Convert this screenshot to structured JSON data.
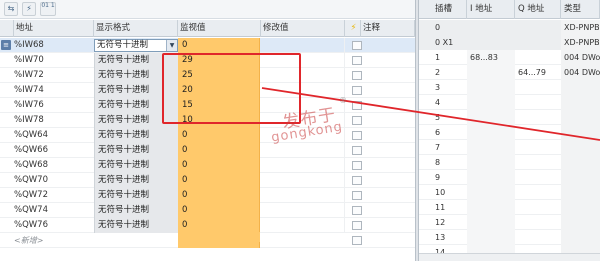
{
  "toolbar": {
    "buttons": [
      {
        "name": "monitor-all-icon",
        "glyph": "⇆"
      },
      {
        "name": "modify-values-icon",
        "glyph": "⚡"
      },
      {
        "name": "monitor-once-icon",
        "glyph": "01\n1"
      }
    ]
  },
  "watch_table": {
    "headers": {
      "address": "地址",
      "format": "显示格式",
      "monitor": "监视值",
      "modify": "修改值",
      "flash_icon": "",
      "comment": "注释"
    },
    "rows": [
      {
        "address": "%IW68",
        "format": "无符号十进制",
        "monitor": "0",
        "selected": true
      },
      {
        "address": "%IW70",
        "format": "无符号十进制",
        "monitor": "29"
      },
      {
        "address": "%IW72",
        "format": "无符号十进制",
        "monitor": "25"
      },
      {
        "address": "%IW74",
        "format": "无符号十进制",
        "monitor": "20"
      },
      {
        "address": "%IW76",
        "format": "无符号十进制",
        "monitor": "15"
      },
      {
        "address": "%IW78",
        "format": "无符号十进制",
        "monitor": "10"
      },
      {
        "address": "%QW64",
        "format": "无符号十进制",
        "monitor": "0"
      },
      {
        "address": "%QW66",
        "format": "无符号十进制",
        "monitor": "0"
      },
      {
        "address": "%QW68",
        "format": "无符号十进制",
        "monitor": "0"
      },
      {
        "address": "%QW70",
        "format": "无符号十进制",
        "monitor": "0"
      },
      {
        "address": "%QW72",
        "format": "无符号十进制",
        "monitor": "0"
      },
      {
        "address": "%QW74",
        "format": "无符号十进制",
        "monitor": "0"
      },
      {
        "address": "%QW76",
        "format": "无符号十进制",
        "monitor": "0"
      }
    ],
    "add_new": "<新增>"
  },
  "io_table": {
    "headers": {
      "slot": "插槽",
      "i_addr": "I 地址",
      "q_addr": "Q 地址",
      "type": "类型"
    },
    "rows": [
      {
        "slot": "0",
        "i": "",
        "q": "",
        "type": "XD-PNPB"
      },
      {
        "slot": "0 X1",
        "i": "",
        "q": "",
        "type": "XD-PNPB"
      },
      {
        "slot": "1",
        "i": "68...83",
        "q": "",
        "type": "004 DWo"
      },
      {
        "slot": "2",
        "i": "",
        "q": "64...79",
        "type": "004 DWo"
      },
      {
        "slot": "3",
        "i": "",
        "q": "",
        "type": ""
      },
      {
        "slot": "4",
        "i": "",
        "q": "",
        "type": ""
      },
      {
        "slot": "5",
        "i": "",
        "q": "",
        "type": ""
      },
      {
        "slot": "6",
        "i": "",
        "q": "",
        "type": ""
      },
      {
        "slot": "7",
        "i": "",
        "q": "",
        "type": ""
      },
      {
        "slot": "8",
        "i": "",
        "q": "",
        "type": ""
      },
      {
        "slot": "9",
        "i": "",
        "q": "",
        "type": ""
      },
      {
        "slot": "10",
        "i": "",
        "q": "",
        "type": ""
      },
      {
        "slot": "11",
        "i": "",
        "q": "",
        "type": ""
      },
      {
        "slot": "12",
        "i": "",
        "q": "",
        "type": ""
      },
      {
        "slot": "13",
        "i": "",
        "q": "",
        "type": ""
      },
      {
        "slot": "14",
        "i": "",
        "q": "",
        "type": ""
      }
    ]
  },
  "watermark": {
    "line1": "发布于",
    "line2": "gongkong",
    "reg": "®"
  },
  "colors": {
    "monitor_column": "#ffc96b",
    "highlight": "#e0262b",
    "selected_row": "#dde9f7"
  }
}
